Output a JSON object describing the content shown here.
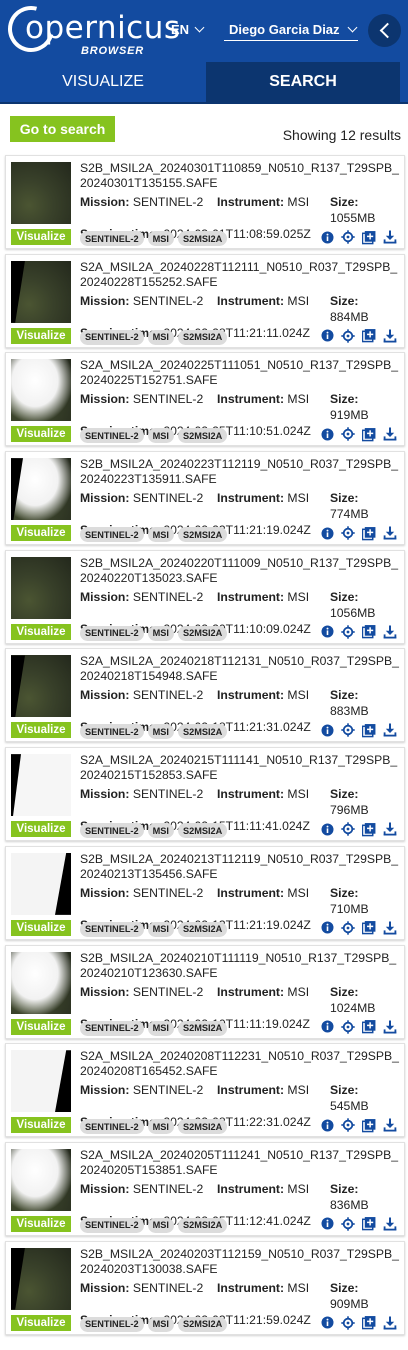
{
  "header": {
    "logo_text": "opernicus",
    "logo_subtitle": "BROWSER",
    "language": "EN",
    "user_name": "Diego Garcia Diaz"
  },
  "tabs": [
    {
      "label": "VISUALIZE",
      "active": false
    },
    {
      "label": "SEARCH",
      "active": true
    }
  ],
  "toolbar": {
    "goto_label": "Go to search",
    "results_text": "Showing 12 results"
  },
  "labels": {
    "mission": "Mission:",
    "instrument": "Instrument:",
    "size": "Size:",
    "sensing_time": "Sensing time:",
    "visualize": "Visualize"
  },
  "colors": {
    "header_bg": "#134ba0",
    "active_tab_bg": "#0c356f",
    "accent_green": "#86c31f",
    "action_icon_blue": "#134ba0"
  },
  "action_icons": [
    "info-icon",
    "crosshair-icon",
    "add-to-list-icon",
    "download-icon"
  ],
  "results": [
    {
      "name": "S2B_MSIL2A_20240301T110859_N0510_R137_T29SPB_20240301T135155.SAFE",
      "mission": "SENTINEL-2",
      "instrument": "MSI",
      "size": "1055MB",
      "sensing_time": "2024-03-01T11:08:59.025Z",
      "tags": [
        "SENTINEL-2",
        "MSI",
        "S2MSI2A"
      ],
      "thumb": "land"
    },
    {
      "name": "S2A_MSIL2A_20240228T112111_N0510_R037_T29SPB_20240228T155252.SAFE",
      "mission": "SENTINEL-2",
      "instrument": "MSI",
      "size": "884MB",
      "sensing_time": "2024-02-28T11:21:11.024Z",
      "tags": [
        "SENTINEL-2",
        "MSI",
        "S2MSI2A"
      ],
      "thumb": "land-edge"
    },
    {
      "name": "S2A_MSIL2A_20240225T111051_N0510_R137_T29SPB_20240225T152751.SAFE",
      "mission": "SENTINEL-2",
      "instrument": "MSI",
      "size": "919MB",
      "sensing_time": "2024-02-25T11:10:51.024Z",
      "tags": [
        "SENTINEL-2",
        "MSI",
        "S2MSI2A"
      ],
      "thumb": "cloud"
    },
    {
      "name": "S2B_MSIL2A_20240223T112119_N0510_R037_T29SPB_20240223T135911.SAFE",
      "mission": "SENTINEL-2",
      "instrument": "MSI",
      "size": "774MB",
      "sensing_time": "2024-02-23T11:21:19.024Z",
      "tags": [
        "SENTINEL-2",
        "MSI",
        "S2MSI2A"
      ],
      "thumb": "cloud-edge"
    },
    {
      "name": "S2B_MSIL2A_20240220T111009_N0510_R137_T29SPB_20240220T135023.SAFE",
      "mission": "SENTINEL-2",
      "instrument": "MSI",
      "size": "1056MB",
      "sensing_time": "2024-02-20T11:10:09.024Z",
      "tags": [
        "SENTINEL-2",
        "MSI",
        "S2MSI2A"
      ],
      "thumb": "land"
    },
    {
      "name": "S2A_MSIL2A_20240218T112131_N0510_R037_T29SPB_20240218T154948.SAFE",
      "mission": "SENTINEL-2",
      "instrument": "MSI",
      "size": "883MB",
      "sensing_time": "2024-02-18T11:21:31.024Z",
      "tags": [
        "SENTINEL-2",
        "MSI",
        "S2MSI2A"
      ],
      "thumb": "land-edge"
    },
    {
      "name": "S2A_MSIL2A_20240215T111141_N0510_R137_T29SPB_20240215T152853.SAFE",
      "mission": "SENTINEL-2",
      "instrument": "MSI",
      "size": "796MB",
      "sensing_time": "2024-02-15T11:11:41.024Z",
      "tags": [
        "SENTINEL-2",
        "MSI",
        "S2MSI2A"
      ],
      "thumb": "white"
    },
    {
      "name": "S2B_MSIL2A_20240213T112119_N0510_R037_T29SPB_20240213T135456.SAFE",
      "mission": "SENTINEL-2",
      "instrument": "MSI",
      "size": "710MB",
      "sensing_time": "2024-02-13T11:21:19.024Z",
      "tags": [
        "SENTINEL-2",
        "MSI",
        "S2MSI2A"
      ],
      "thumb": "white-edge"
    },
    {
      "name": "S2B_MSIL2A_20240210T111119_N0510_R137_T29SPB_20240210T123630.SAFE",
      "mission": "SENTINEL-2",
      "instrument": "MSI",
      "size": "1024MB",
      "sensing_time": "2024-02-10T11:11:19.024Z",
      "tags": [
        "SENTINEL-2",
        "MSI",
        "S2MSI2A"
      ],
      "thumb": "cloud"
    },
    {
      "name": "S2A_MSIL2A_20240208T112231_N0510_R037_T29SPB_20240208T165452.SAFE",
      "mission": "SENTINEL-2",
      "instrument": "MSI",
      "size": "545MB",
      "sensing_time": "2024-02-08T11:22:31.024Z",
      "tags": [
        "SENTINEL-2",
        "MSI",
        "S2MSI2A"
      ],
      "thumb": "white-edge"
    },
    {
      "name": "S2A_MSIL2A_20240205T111241_N0510_R137_T29SPB_20240205T153851.SAFE",
      "mission": "SENTINEL-2",
      "instrument": "MSI",
      "size": "836MB",
      "sensing_time": "2024-02-05T11:12:41.024Z",
      "tags": [
        "SENTINEL-2",
        "MSI",
        "S2MSI2A"
      ],
      "thumb": "cloud"
    },
    {
      "name": "S2B_MSIL2A_20240203T112159_N0510_R037_T29SPB_20240203T130038.SAFE",
      "mission": "SENTINEL-2",
      "instrument": "MSI",
      "size": "909MB",
      "sensing_time": "2024-02-03T11:21:59.024Z",
      "tags": [
        "SENTINEL-2",
        "MSI",
        "S2MSI2A"
      ],
      "thumb": "land-edge"
    }
  ]
}
